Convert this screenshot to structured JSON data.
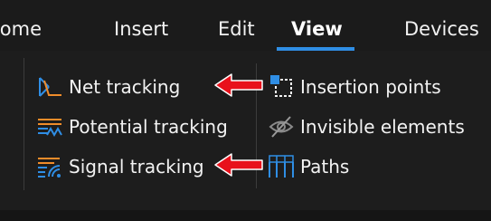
{
  "tabs": [
    {
      "label": "Home"
    },
    {
      "label": "Insert"
    },
    {
      "label": "Edit"
    },
    {
      "label": "View"
    },
    {
      "label": "Devices"
    }
  ],
  "active_tab": "View",
  "left_group": {
    "items": [
      {
        "label": "Net tracking",
        "icon": "net-tracking-icon"
      },
      {
        "label": "Potential tracking",
        "icon": "potential-tracking-icon"
      },
      {
        "label": "Signal tracking",
        "icon": "signal-tracking-icon"
      }
    ]
  },
  "right_group": {
    "items": [
      {
        "label": "Insertion points",
        "icon": "insertion-points-icon"
      },
      {
        "label": "Invisible elements",
        "icon": "invisible-elements-icon"
      },
      {
        "label": "Paths",
        "icon": "paths-icon"
      }
    ]
  },
  "colors": {
    "accent": "#2f8ee5",
    "annotation_arrow": "#e8111b",
    "background": "#1f1f1f",
    "text": "#f2f2f2"
  }
}
